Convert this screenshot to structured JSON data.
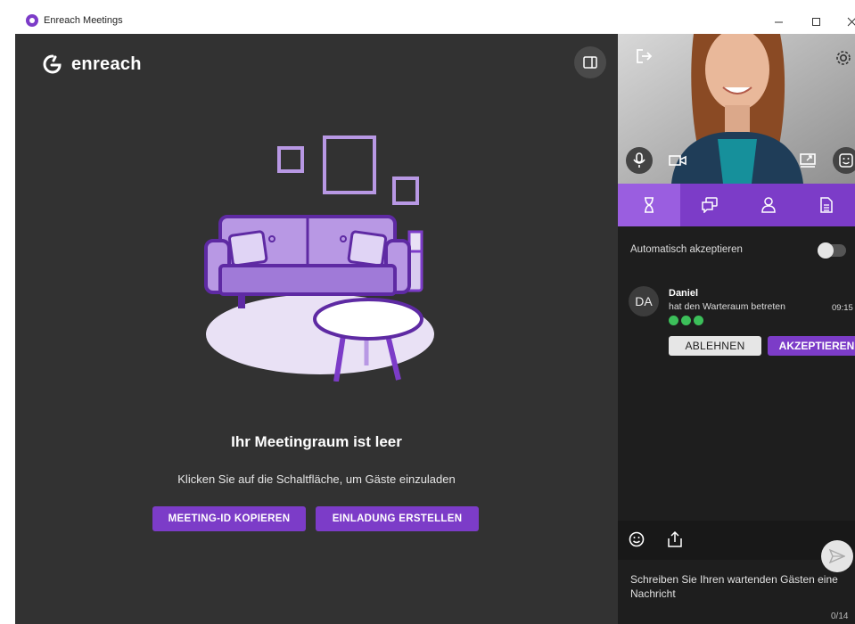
{
  "window": {
    "title": "Enreach Meetings",
    "minimize_icon": "minimize-icon",
    "maximize_icon": "maximize-icon",
    "close_icon": "close-icon"
  },
  "brand": {
    "logo_text": "enreach",
    "accent": "#7c3cc8"
  },
  "main": {
    "empty_title": "Ihr Meetingraum ist leer",
    "empty_subtitle": "Klicken Sie auf die Schaltfläche, um Gäste einzuladen",
    "copy_id_button": "MEETING-ID KOPIEREN",
    "invite_button": "EINLADUNG ERSTELLEN",
    "background": "#323232"
  },
  "side": {
    "video_controls": [
      "leave-icon",
      "settings-icon",
      "microphone-icon",
      "camera-icon",
      "share-screen-icon",
      "emoji-icon"
    ],
    "tabs": [
      {
        "icon": "hourglass-icon",
        "active": true
      },
      {
        "icon": "chat-icon",
        "active": false
      },
      {
        "icon": "person-icon",
        "active": false
      },
      {
        "icon": "document-icon",
        "active": false
      }
    ],
    "auto_accept_label": "Automatisch akzeptieren",
    "auto_accept_on": false,
    "guest": {
      "initials": "DA",
      "name": "Daniel",
      "message": "hat den Warteraum betreten",
      "time": "09:15",
      "reject_label": "ABLEHNEN",
      "accept_label": "AKZEPTIEREN"
    },
    "chat": {
      "placeholder": "Schreiben Sie Ihren wartenden Gästen eine Nachricht",
      "counter": "0/14"
    }
  }
}
